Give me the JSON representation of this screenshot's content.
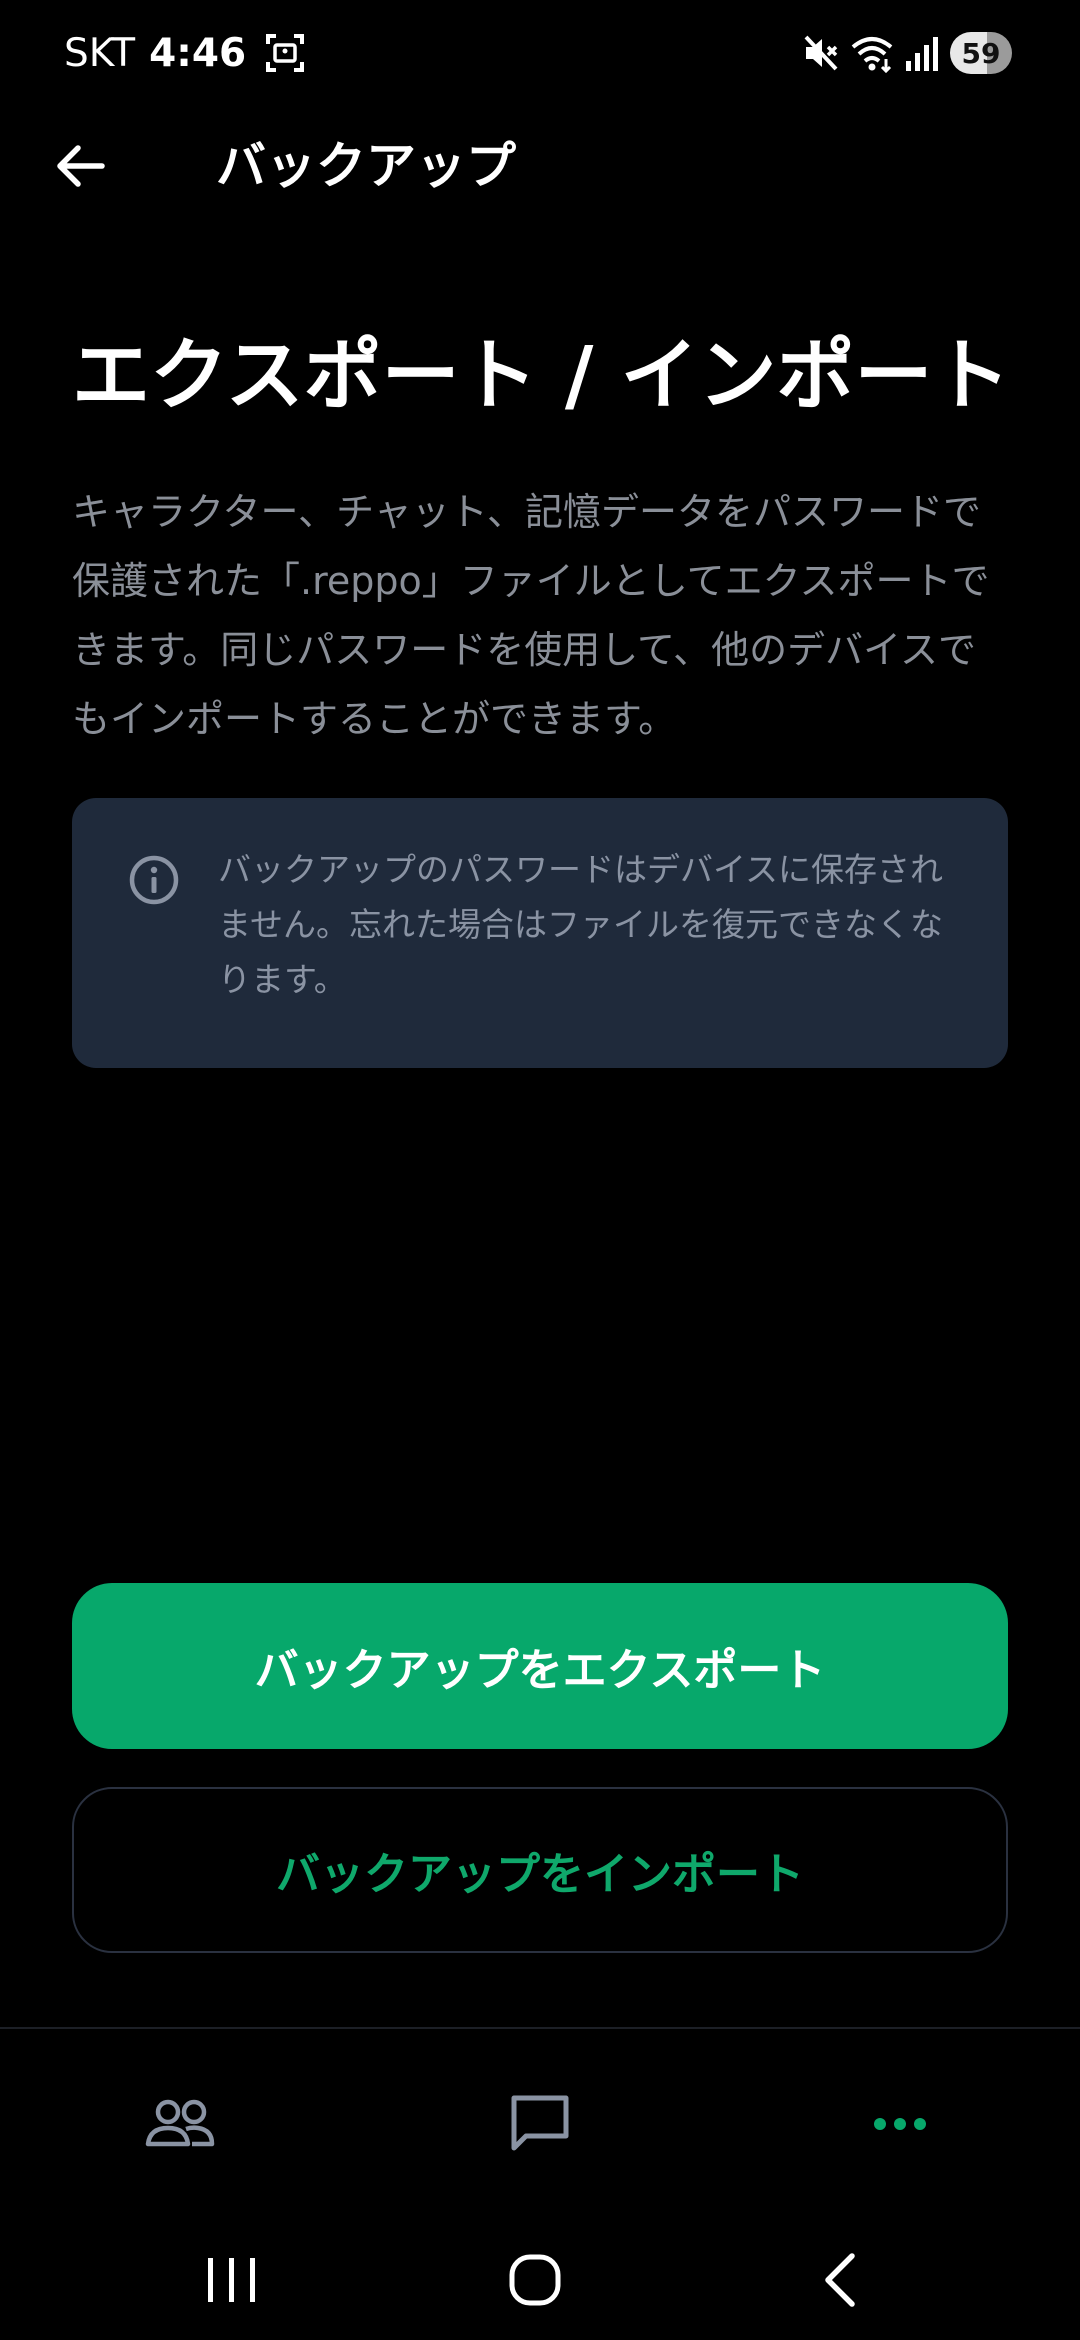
{
  "status_bar": {
    "carrier": "SKT",
    "time": "4:46",
    "battery": "59",
    "icons": [
      "screen-record-icon",
      "mute-icon",
      "wifi-icon",
      "signal-icon"
    ]
  },
  "app_bar": {
    "title": "バックアップ",
    "back_icon": "arrow-left-icon"
  },
  "main": {
    "heading": "エクスポート / インポート",
    "description": "キャラクター、チャット、記憶データをパスワードで保護された「.reppo」ファイルとしてエクスポートできます。同じパスワードを使用して、他のデバイスでもインポートすることができます。",
    "info": {
      "icon": "info-icon",
      "text": "バックアップのパスワードはデバイスに保存されません。忘れた場合はファイルを復元できなくなります。"
    },
    "export_button": "バックアップをエクスポート",
    "import_button": "バックアップをインポート"
  },
  "bottom_nav": {
    "items": [
      {
        "icon": "people-icon",
        "active": false
      },
      {
        "icon": "chat-icon",
        "active": false
      },
      {
        "icon": "more-icon",
        "active": true
      }
    ]
  },
  "system_nav": {
    "icons": [
      "recent-apps-icon",
      "home-icon",
      "system-back-icon"
    ]
  },
  "colors": {
    "background": "#000000",
    "accent": "#07a86b",
    "card": "#1f2a3b",
    "muted_text": "#8a8f98"
  }
}
